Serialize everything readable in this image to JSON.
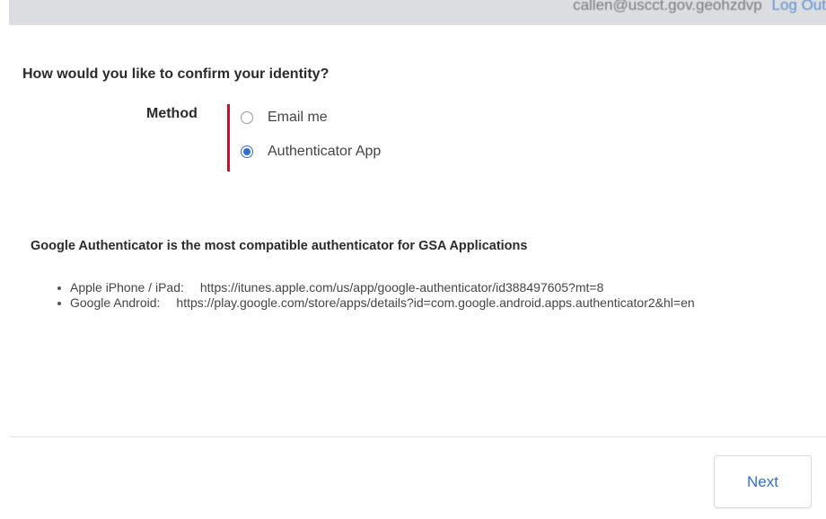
{
  "header": {
    "user_email": "callen@uscct.gov.geohzdvp",
    "logout_label": "Log Out"
  },
  "form": {
    "question": "How would you like to confirm your identity?",
    "method_label": "Method",
    "options": [
      {
        "label": "Email me",
        "selected": false
      },
      {
        "label": "Authenticator App",
        "selected": true
      }
    ]
  },
  "authenticator_info": {
    "heading": "Google Authenticator is the most compatible authenticator for GSA Applications",
    "apps": [
      {
        "platform": "Apple iPhone / iPad:",
        "url": "https://itunes.apple.com/us/app/google-authenticator/id388497605?mt=8"
      },
      {
        "platform": "Google Android:",
        "url": "https://play.google.com/store/apps/details?id=com.google.android.apps.authenticator2&hl=en"
      }
    ]
  },
  "footer": {
    "next_label": "Next"
  },
  "colors": {
    "accent": "#2f6fd6",
    "required_marker": "#c8102e",
    "header_bg": "#dcdde0"
  }
}
